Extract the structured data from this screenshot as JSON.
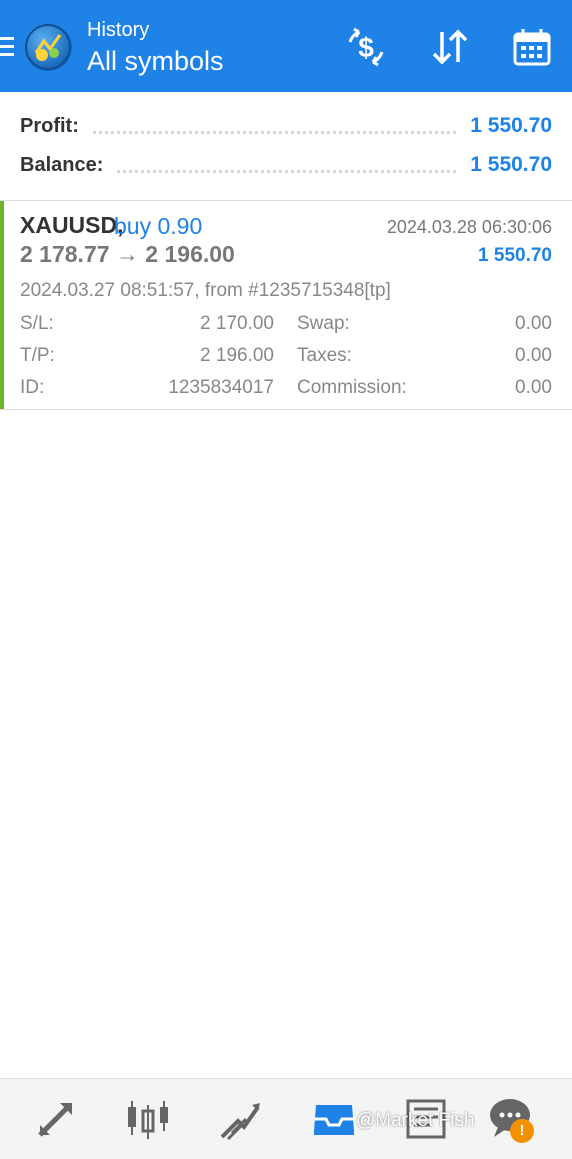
{
  "header": {
    "title_small": "History",
    "title_main": "All symbols",
    "icons": {
      "menu": "menu-icon",
      "logo": "app-logo-icon",
      "currency": "currency-exchange-icon",
      "sort": "sort-icon",
      "calendar": "calendar-icon"
    },
    "color": "#1e82e6"
  },
  "summary": {
    "profit_label": "Profit:",
    "profit_value": "1 550.70",
    "balance_label": "Balance:",
    "balance_value": "1 550.70"
  },
  "deal": {
    "symbol": "XAUUSD,",
    "side": "buy 0.90",
    "close_time": "2024.03.28 06:30:06",
    "prices": "2 178.77 → 2 196.00",
    "profit": "1 550.70",
    "open_info": "2024.03.27 08:51:57, from #1235715348[tp]",
    "sl_label": "S/L:",
    "sl_value": "2 170.00",
    "tp_label": "T/P:",
    "tp_value": "2 196.00",
    "id_label": "ID:",
    "id_value": "1235834017",
    "swap_label": "Swap:",
    "swap_value": "0.00",
    "taxes_label": "Taxes:",
    "taxes_value": "0.00",
    "commission_label": "Commission:",
    "commission_value": "0.00",
    "bar_color": "#6cb52a"
  },
  "bottom_nav": {
    "items": [
      "quotes-icon",
      "chart-icon",
      "trade-icon",
      "history-icon",
      "news-icon",
      "chat-icon"
    ],
    "watermark": "@Market Fish",
    "badge": "!"
  }
}
